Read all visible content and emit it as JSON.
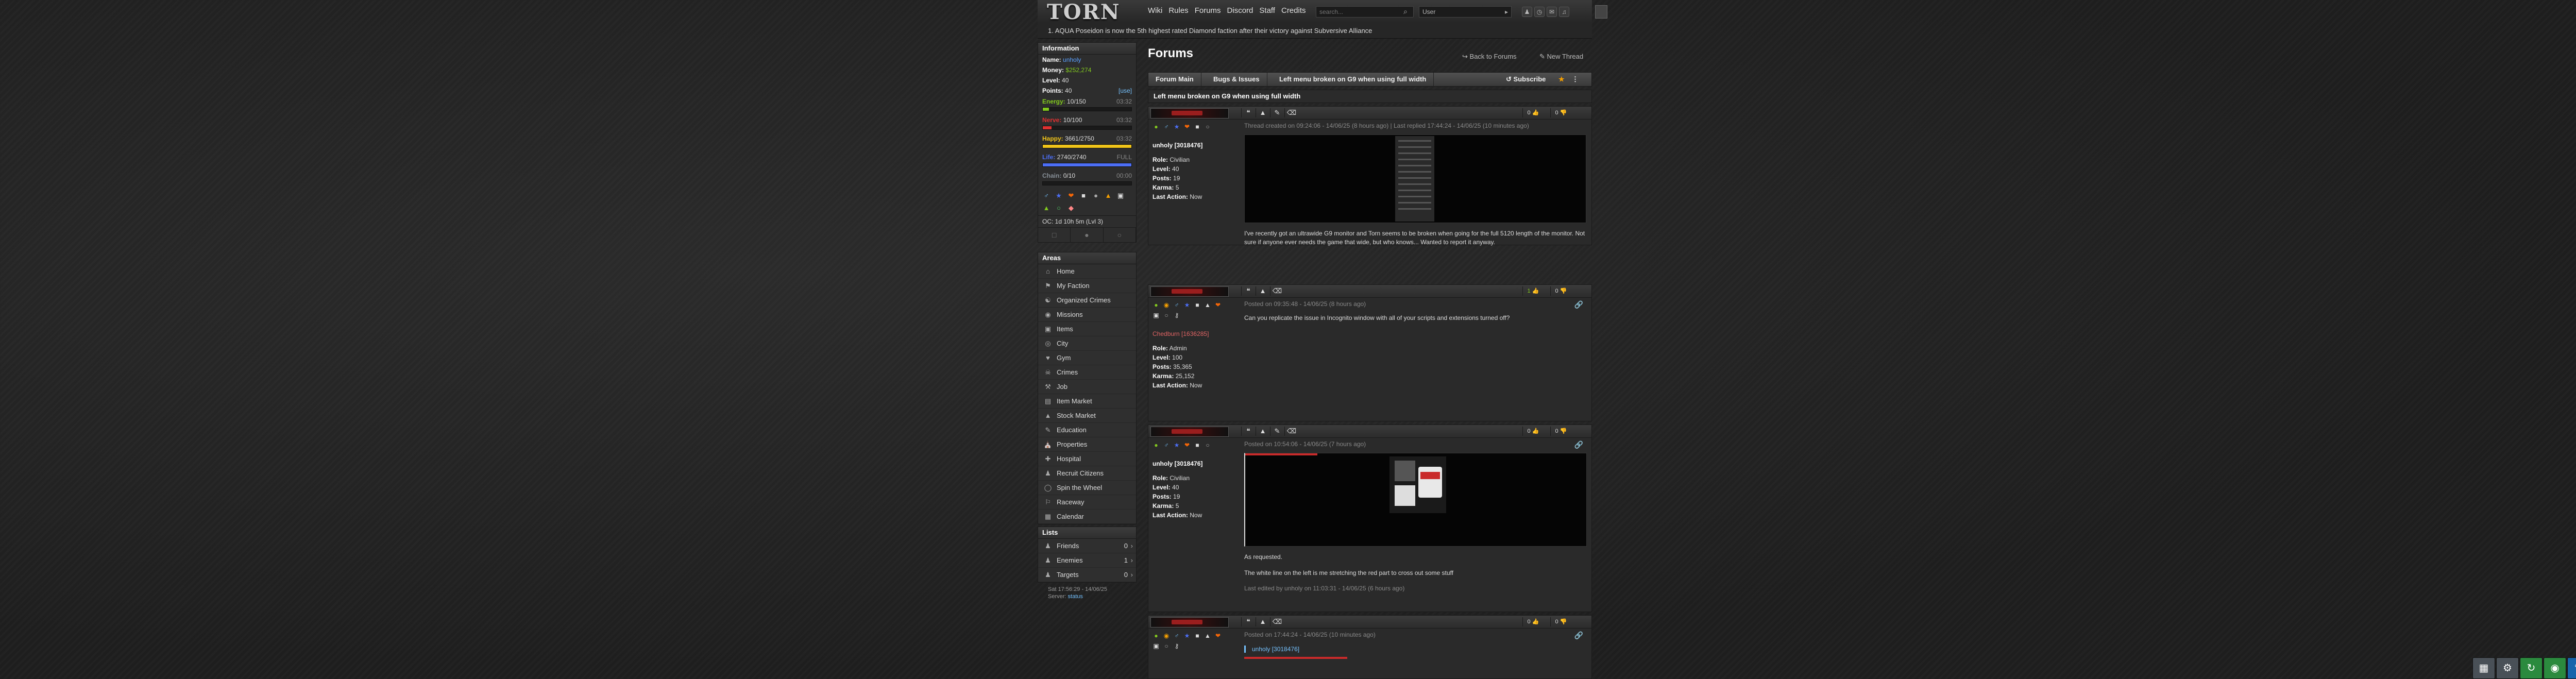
{
  "header": {
    "logo": "TORN",
    "nav": [
      "Wiki",
      "Rules",
      "Forums",
      "Discord",
      "Staff",
      "Credits"
    ],
    "search_placeholder": "search...",
    "search_category": "User",
    "news": "AQUA Poseidon is now the 5th highest rated Diamond faction after their victory against Subversive Alliance",
    "news_index": "1."
  },
  "sidebar": {
    "information_title": "Information",
    "name_label": "Name:",
    "name": "unholy",
    "money_label": "Money:",
    "money": "$252,274",
    "level_label": "Level:",
    "level": "40",
    "points_label": "Points:",
    "points": "40",
    "points_action": "[use]",
    "bars": [
      {
        "label": "Energy:",
        "value": "10/150",
        "time": "03:32",
        "color": "#82c91e",
        "fraction": 0.067
      },
      {
        "label": "Nerve:",
        "value": "10/100",
        "time": "03:32",
        "color": "#e03131",
        "fraction": 0.1
      },
      {
        "label": "Happy:",
        "value": "3661/2750",
        "time": "03:32",
        "color": "#f0c419",
        "fraction": 1.0
      },
      {
        "label": "Life:",
        "value": "2740/2740",
        "time": "FULL",
        "color": "#4c6ef5",
        "fraction": 1.0
      },
      {
        "label": "Chain:",
        "value": "0/10",
        "time": "00:00",
        "color": "#868e96",
        "fraction": 0.0
      }
    ],
    "oc": "OC: 1d 10h 5m (Lvl 3)",
    "areas_title": "Areas",
    "areas": [
      "Home",
      "My Faction",
      "Organized Crimes",
      "Missions",
      "Items",
      "City",
      "Gym",
      "Crimes",
      "Job",
      "Item Market",
      "Stock Market",
      "Education",
      "Properties",
      "Hospital",
      "Recruit Citizens",
      "Spin the Wheel",
      "Raceway",
      "Calendar"
    ],
    "lists_title": "Lists",
    "lists": [
      {
        "label": "Friends",
        "count": "0"
      },
      {
        "label": "Enemies",
        "count": "1"
      },
      {
        "label": "Targets",
        "count": "0"
      }
    ],
    "footer_time": "Sat 17:56:29 - 14/06/25",
    "footer_server_label": "Server:",
    "footer_server": "status"
  },
  "main": {
    "title": "Forums",
    "back": "Back to Forums",
    "new_thread": "New Thread",
    "crumbs": [
      "Forum Main",
      "Bugs & Issues",
      "Left menu broken on G9 when using full width"
    ],
    "subscribe": "Subscribe",
    "thread_title": "Left menu broken on G9 when using full width",
    "posts": [
      {
        "meta": "Thread created on 09:24:06 - 14/06/25 (8 hours ago) | Last replied 17:44:24 - 14/06/25 (10 minutes ago)",
        "author": "unholy [3018476]",
        "stats": [
          [
            "Role:",
            "Civilian"
          ],
          [
            "Level:",
            "40"
          ],
          [
            "Posts:",
            "19"
          ],
          [
            "Karma:",
            "5"
          ],
          [
            "Last Action:",
            "Now"
          ]
        ],
        "body": "I've recently got an ultrawide G9 monitor and Torn seems to be broken when going for the full 5120 length of the monitor. Not sure if anyone ever needs the game that wide, but who knows... Wanted to report it anyway.",
        "likes": "0",
        "dislikes": "0"
      },
      {
        "meta": "Posted on 09:35:48 - 14/06/25 (8 hours ago)",
        "author": "Chedburn [1636285]",
        "stats": [
          [
            "Role:",
            "Admin"
          ],
          [
            "Level:",
            "100"
          ],
          [
            "Posts:",
            "35,365"
          ],
          [
            "Karma:",
            "25,152"
          ],
          [
            "Last Action:",
            "Now"
          ]
        ],
        "body": "Can you replicate the issue in Incognito window with all of your scripts and extensions turned off?",
        "likes": "1",
        "dislikes": "0"
      },
      {
        "meta": "Posted on 10:54:06 - 14/06/25 (7 hours ago)",
        "author": "unholy [3018476]",
        "stats": [
          [
            "Role:",
            "Civilian"
          ],
          [
            "Level:",
            "40"
          ],
          [
            "Posts:",
            "19"
          ],
          [
            "Karma:",
            "5"
          ],
          [
            "Last Action:",
            "Now"
          ]
        ],
        "body1": "As requested.",
        "body2": "The white line on the left is me stretching the red part to cross out some stuff",
        "edit": "Last edited by unholy on 11:03:31 - 14/06/25 (6 hours ago)",
        "likes": "0",
        "dislikes": "0"
      },
      {
        "meta": "Posted on 17:44:24 - 14/06/25 (10 minutes ago)",
        "quote_author": "unholy [3018476]",
        "likes": "0",
        "dislikes": "0"
      }
    ]
  },
  "colors": {
    "accent_green": "#82c91e",
    "link_blue": "#74c0fc",
    "admin_red": "#e06464"
  }
}
